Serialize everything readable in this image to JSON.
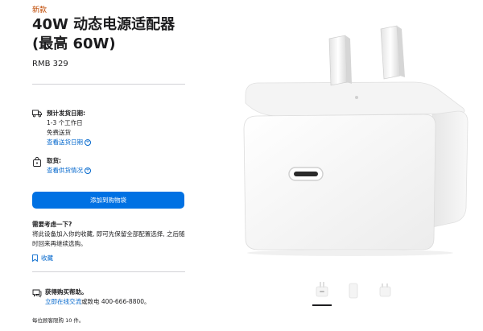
{
  "product": {
    "badge": "新款",
    "title_line1": "40W 动态电源适配器",
    "title_line2": "(最高 60W)",
    "price": "RMB 329"
  },
  "delivery": {
    "heading": "预计发货日期:",
    "line1": "1-3 个工作日",
    "line2": "免费送货",
    "link": "查看送货日期"
  },
  "pickup": {
    "heading": "取货:",
    "link": "查看供货情况"
  },
  "actions": {
    "add_to_bag": "添加到购物袋",
    "save": "收藏"
  },
  "consider": {
    "heading": "需要考虑一下?",
    "text": "将此设备加入你的收藏, 即可先保留全部配置选择, 之后随时回来再继续选购。"
  },
  "help": {
    "heading": "获得购买帮助。",
    "chat_link": "立即在线交流",
    "phone_text": "或致电 400-666-8800。",
    "limit": "每位顾客限购 10 件。"
  },
  "colors": {
    "accent": "#0071e3",
    "link": "#0066cc",
    "badge": "#bf4800"
  }
}
